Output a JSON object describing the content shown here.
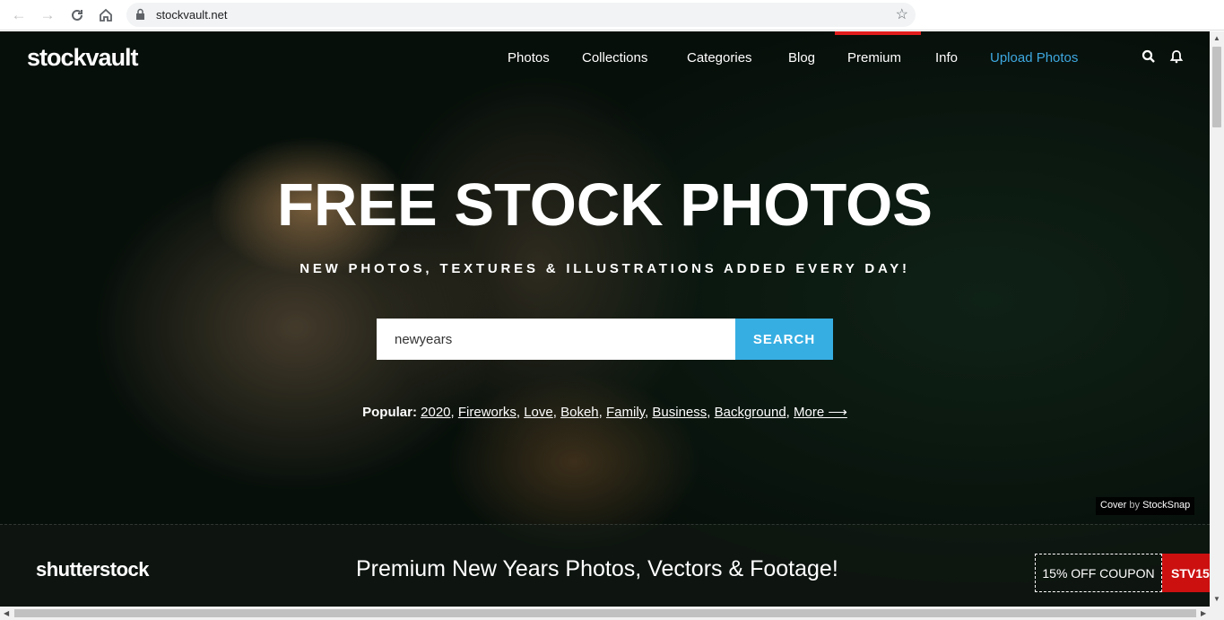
{
  "browser": {
    "url": "stockvault.net"
  },
  "site": {
    "logo": "stockvault",
    "nav": [
      "Photos",
      "Collections",
      "Categories",
      "Blog",
      "Premium",
      "Info",
      "Upload Photos"
    ],
    "accent_color": "#36aee2",
    "premium_marker_color": "#e21c1c"
  },
  "hero": {
    "title": "FREE STOCK PHOTOS",
    "subtitle": "NEW PHOTOS, TEXTURES & ILLUSTRATIONS ADDED EVERY DAY!",
    "search_value": "newyears",
    "search_button": "SEARCH",
    "popular_label": "Popular:",
    "popular_links": [
      "2020",
      "Fireworks",
      "Love",
      "Bokeh",
      "Family",
      "Business",
      "Background",
      "More ⟶"
    ],
    "cover_prefix": "Cover",
    "cover_by": "by",
    "cover_source": "StockSnap"
  },
  "ad": {
    "brand": "shutterstock",
    "text": "Premium New Years Photos, Vectors & Footage!",
    "coupon": "15% OFF COUPON",
    "code": "STV15"
  }
}
